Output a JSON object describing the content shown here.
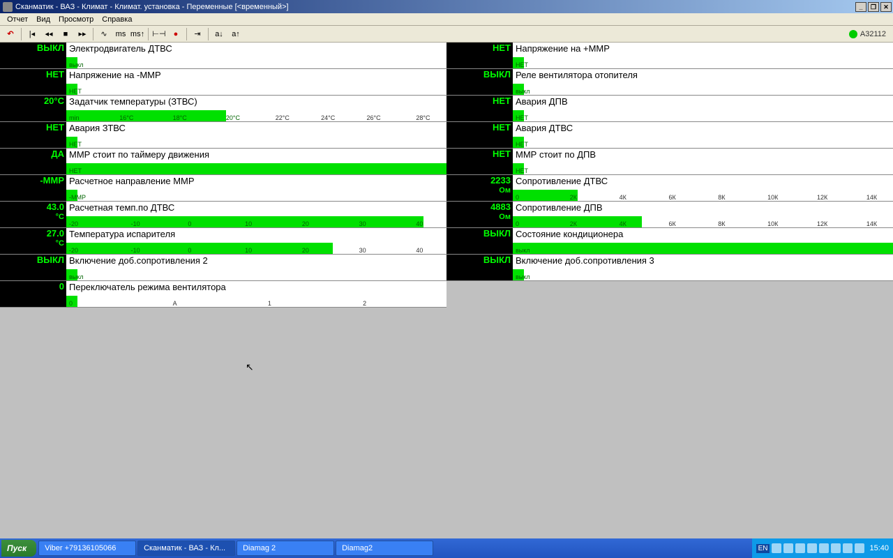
{
  "window": {
    "title": "Сканматик - ВАЗ - Климат - Климат. установка - Переменные [<временный>]"
  },
  "menu": {
    "report": "Отчет",
    "view": "Вид",
    "browse": "Просмотр",
    "help": "Справка"
  },
  "toolbar": {
    "status_id": "А32112"
  },
  "rows_left": [
    {
      "value": "ВЫКЛ",
      "unit": "",
      "label": "Электродвигатель ДТВС",
      "bar_pct": 3,
      "bar_text": "выкл",
      "ticks": []
    },
    {
      "value": "НЕТ",
      "unit": "",
      "label": "Напряжение на -ММР",
      "bar_pct": 3,
      "bar_text": "НЕТ",
      "ticks": []
    },
    {
      "value": "20°C",
      "unit": "",
      "label": "Задатчик температуры (ЗТВС)",
      "bar_pct": 42,
      "bar_text": "min",
      "ticks": [
        {
          "t": "16°C",
          "p": 14
        },
        {
          "t": "18°C",
          "p": 28
        },
        {
          "t": "20°C",
          "p": 42
        },
        {
          "t": "22°C",
          "p": 55
        },
        {
          "t": "24°C",
          "p": 67
        },
        {
          "t": "26°C",
          "p": 79
        },
        {
          "t": "28°C",
          "p": 92
        }
      ]
    },
    {
      "value": "НЕТ",
      "unit": "",
      "label": "Авария ЗТВС",
      "bar_pct": 3,
      "bar_text": "НЕТ",
      "ticks": []
    },
    {
      "value": "ДА",
      "unit": "",
      "label": "ММР стоит по таймеру движения",
      "bar_pct": 100,
      "bar_text": "НЕТ",
      "ticks": []
    },
    {
      "value": "-ММР",
      "unit": "",
      "label": "Расчетное направление ММР",
      "bar_pct": 3,
      "bar_text": "-ММР",
      "ticks": []
    },
    {
      "value": "43.0",
      "unit": "°C",
      "label": "Расчетная темп.по ДТВС",
      "bar_pct": 94,
      "bar_text": "-20",
      "ticks": [
        {
          "t": "-10",
          "p": 17
        },
        {
          "t": "0",
          "p": 32
        },
        {
          "t": "10",
          "p": 47
        },
        {
          "t": "20",
          "p": 62
        },
        {
          "t": "30",
          "p": 77
        },
        {
          "t": "40",
          "p": 92
        }
      ]
    },
    {
      "value": "27.0",
      "unit": "°C",
      "label": "Температура испарителя",
      "bar_pct": 70,
      "bar_text": "-20",
      "ticks": [
        {
          "t": "-10",
          "p": 17
        },
        {
          "t": "0",
          "p": 32
        },
        {
          "t": "10",
          "p": 47
        },
        {
          "t": "20",
          "p": 62
        },
        {
          "t": "30",
          "p": 77
        },
        {
          "t": "40",
          "p": 92
        }
      ]
    },
    {
      "value": "ВЫКЛ",
      "unit": "",
      "label": "Включение доб.сопротивления 2",
      "bar_pct": 3,
      "bar_text": "выкл",
      "ticks": []
    },
    {
      "value": "0",
      "unit": "",
      "label": "Переключатель режима вентилятора",
      "bar_pct": 3,
      "bar_text": "0",
      "ticks": [
        {
          "t": "А",
          "p": 28
        },
        {
          "t": "1",
          "p": 53
        },
        {
          "t": "2",
          "p": 78
        }
      ]
    }
  ],
  "rows_right": [
    {
      "value": "НЕТ",
      "unit": "",
      "label": "Напряжение на +ММР",
      "bar_pct": 3,
      "bar_text": "НЕТ",
      "ticks": []
    },
    {
      "value": "ВЫКЛ",
      "unit": "",
      "label": "Реле вентилятора отопителя",
      "bar_pct": 3,
      "bar_text": "выкл",
      "ticks": []
    },
    {
      "value": "НЕТ",
      "unit": "",
      "label": "Авария ДПВ",
      "bar_pct": 3,
      "bar_text": "НЕТ",
      "ticks": []
    },
    {
      "value": "НЕТ",
      "unit": "",
      "label": "Авария ДТВС",
      "bar_pct": 3,
      "bar_text": "НЕТ",
      "ticks": []
    },
    {
      "value": "НЕТ",
      "unit": "",
      "label": "ММР стоит по ДПВ",
      "bar_pct": 3,
      "bar_text": "НЕТ",
      "ticks": []
    },
    {
      "value": "2233",
      "unit": "Ом",
      "label": "Сопротивление ДТВС",
      "bar_pct": 17,
      "bar_text": "0",
      "ticks": [
        {
          "t": "2К",
          "p": 15
        },
        {
          "t": "4К",
          "p": 28
        },
        {
          "t": "6К",
          "p": 41
        },
        {
          "t": "8К",
          "p": 54
        },
        {
          "t": "10К",
          "p": 67
        },
        {
          "t": "12К",
          "p": 80
        },
        {
          "t": "14К",
          "p": 93
        }
      ]
    },
    {
      "value": "4883",
      "unit": "Ом",
      "label": "Сопротивление ДПВ",
      "bar_pct": 34,
      "bar_text": "0",
      "ticks": [
        {
          "t": "2К",
          "p": 15
        },
        {
          "t": "4К",
          "p": 28
        },
        {
          "t": "6К",
          "p": 41
        },
        {
          "t": "8К",
          "p": 54
        },
        {
          "t": "10К",
          "p": 67
        },
        {
          "t": "12К",
          "p": 80
        },
        {
          "t": "14К",
          "p": 93
        }
      ]
    },
    {
      "value": "ВЫКЛ",
      "unit": "",
      "label": "Состояние кондиционера",
      "bar_pct": 100,
      "bar_text": "выкл",
      "ticks": []
    },
    {
      "value": "ВЫКЛ",
      "unit": "",
      "label": "Включение доб.сопротивления 3",
      "bar_pct": 3,
      "bar_text": "выкл",
      "ticks": []
    }
  ],
  "taskbar": {
    "start": "Пуск",
    "tasks": [
      {
        "label": "Viber +79136105066",
        "active": false
      },
      {
        "label": "Сканматик - ВАЗ - Кл...",
        "active": true
      },
      {
        "label": "Diamag 2",
        "active": false
      },
      {
        "label": "Diamag2",
        "active": false
      }
    ],
    "clock": "15:40",
    "lang": "EN"
  }
}
